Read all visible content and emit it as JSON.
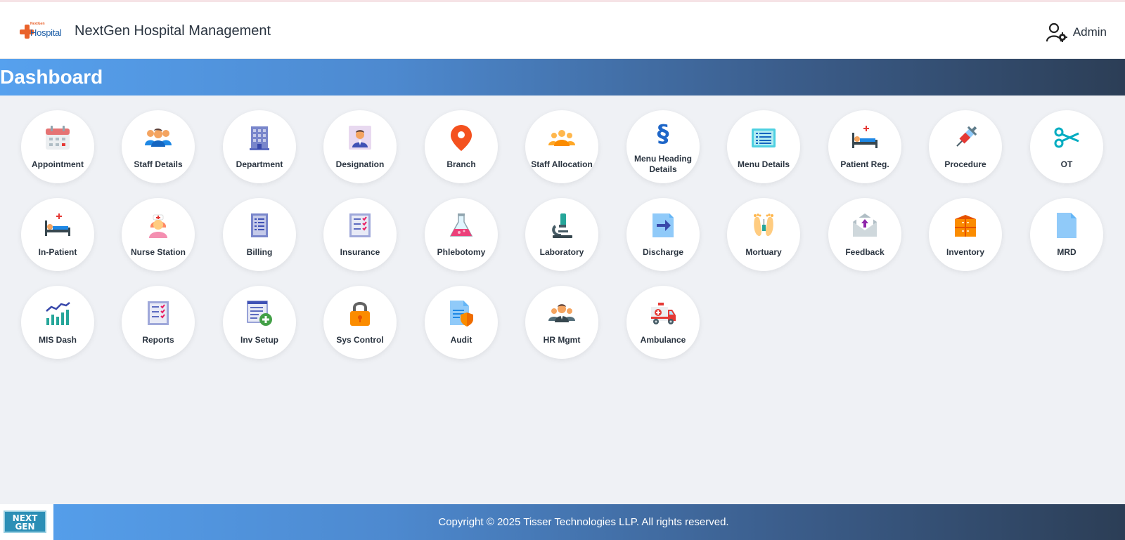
{
  "header": {
    "logo_text": "Hospital",
    "logo_small_text": "NextGen",
    "app_title": "NextGen Hospital Management",
    "user_label": "Admin"
  },
  "banner": {
    "title": "Dashboard"
  },
  "tiles": [
    {
      "label": "Appointment",
      "icon": "calendar-icon"
    },
    {
      "label": "Staff Details",
      "icon": "users-icon"
    },
    {
      "label": "Department",
      "icon": "building-icon"
    },
    {
      "label": "Designation",
      "icon": "id-badge-icon"
    },
    {
      "label": "Branch",
      "icon": "map-pin-icon"
    },
    {
      "label": "Staff Allocation",
      "icon": "group-icon"
    },
    {
      "label": "Menu Heading Details",
      "icon": "section-sign-icon"
    },
    {
      "label": "Menu Details",
      "icon": "list-icon"
    },
    {
      "label": "Patient Reg.",
      "icon": "hospital-bed-icon"
    },
    {
      "label": "Procedure",
      "icon": "syringe-icon"
    },
    {
      "label": "OT",
      "icon": "scissors-icon"
    },
    {
      "label": "In-Patient",
      "icon": "bed-icon"
    },
    {
      "label": "Nurse Station",
      "icon": "nurse-icon"
    },
    {
      "label": "Billing",
      "icon": "invoice-icon"
    },
    {
      "label": "Insurance",
      "icon": "checklist-icon"
    },
    {
      "label": "Phlebotomy",
      "icon": "flask-icon"
    },
    {
      "label": "Laboratory",
      "icon": "microscope-icon"
    },
    {
      "label": "Discharge",
      "icon": "exit-arrow-icon"
    },
    {
      "label": "Mortuary",
      "icon": "feet-tag-icon"
    },
    {
      "label": "Feedback",
      "icon": "envelope-icon"
    },
    {
      "label": "Inventory",
      "icon": "cabinet-icon"
    },
    {
      "label": "MRD",
      "icon": "file-icon"
    },
    {
      "label": "MIS Dash",
      "icon": "bar-chart-icon"
    },
    {
      "label": "Reports",
      "icon": "report-checklist-icon"
    },
    {
      "label": "Inv Setup",
      "icon": "add-list-icon"
    },
    {
      "label": "Sys Control",
      "icon": "lock-icon"
    },
    {
      "label": "Audit",
      "icon": "shield-document-icon"
    },
    {
      "label": "HR Mgmt",
      "icon": "team-icon"
    },
    {
      "label": "Ambulance",
      "icon": "ambulance-icon"
    }
  ],
  "footer": {
    "logo_text": "NEXT GEN",
    "copyright": "Copyright © 2025 Tisser Technologies LLP. All rights reserved."
  }
}
